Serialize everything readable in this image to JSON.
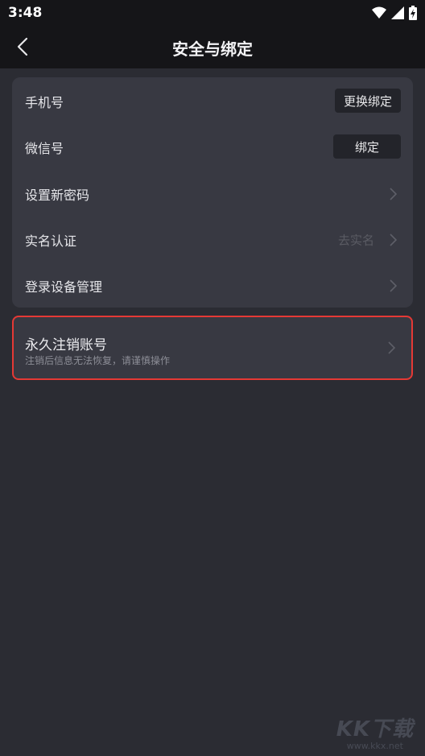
{
  "status_bar": {
    "time": "3:48"
  },
  "header": {
    "title": "安全与绑定"
  },
  "rows": [
    {
      "label": "手机号",
      "button": "更换绑定"
    },
    {
      "label": "微信号",
      "button": "绑定"
    },
    {
      "label": "设置新密码"
    },
    {
      "label": "实名认证",
      "hint": "去实名"
    },
    {
      "label": "登录设备管理"
    }
  ],
  "delete_account": {
    "title": "永久注销账号",
    "subtitle": "注销后信息无法恢复，请谨慎操作"
  },
  "watermark": {
    "logo": "KK下载",
    "url": "www.kkx.net"
  },
  "colors": {
    "background": "#2b2c33",
    "card": "#383942",
    "highlight": "#e53935"
  }
}
